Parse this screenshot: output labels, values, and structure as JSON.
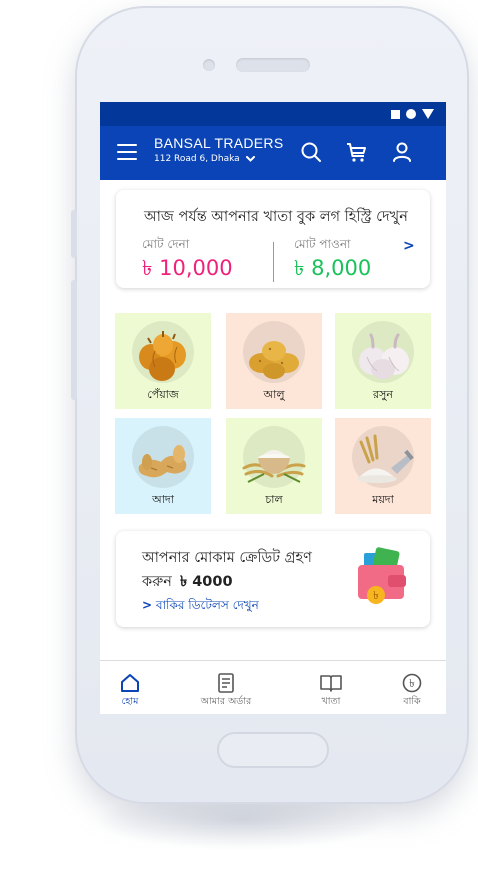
{
  "header": {
    "shop_name": "BANSAL TRADERS",
    "address": "112 Road 6, Dhaka"
  },
  "ledger": {
    "title": "আজ পর্যন্ত আপনার খাতা বুক লগ হিস্ট্রি দেখুন",
    "payable_label": "মোট দেনা",
    "payable_amount": "৳ 10,000",
    "receivable_label": "মোট পাওনা",
    "receivable_amount": "৳ 8,000",
    "payable_color": "#f0217b",
    "receivable_color": "#19c25a"
  },
  "categories": [
    {
      "label": "পেঁয়াজ",
      "icon": "onion-icon",
      "bg": "#eefbd2"
    },
    {
      "label": "আলু",
      "icon": "potato-icon",
      "bg": "#fde6d8"
    },
    {
      "label": "রসুন",
      "icon": "garlic-icon",
      "bg": "#eefbd2"
    },
    {
      "label": "আদা",
      "icon": "ginger-icon",
      "bg": "#d8f3fb"
    },
    {
      "label": "চাল",
      "icon": "rice-icon",
      "bg": "#eefbd2"
    },
    {
      "label": "ময়দা",
      "icon": "flour-icon",
      "bg": "#fde6d8"
    }
  ],
  "credit": {
    "line1": "আপনার মোকাম ক্রেডিট গ্রহণ",
    "line2_prefix": "করুন",
    "amount": "৳ 4000",
    "link": "বাকির ডিটেলস দেখুন"
  },
  "nav": [
    {
      "label": "হোম",
      "icon": "home-icon",
      "active": true
    },
    {
      "label": "আমার অর্ডার",
      "icon": "order-list-icon",
      "active": false
    },
    {
      "label": "খাতা",
      "icon": "book-icon",
      "active": false
    },
    {
      "label": "বাকি",
      "icon": "taka-icon",
      "active": false
    }
  ],
  "colors": {
    "primary": "#0b44b6",
    "statusbar": "#03379a"
  }
}
